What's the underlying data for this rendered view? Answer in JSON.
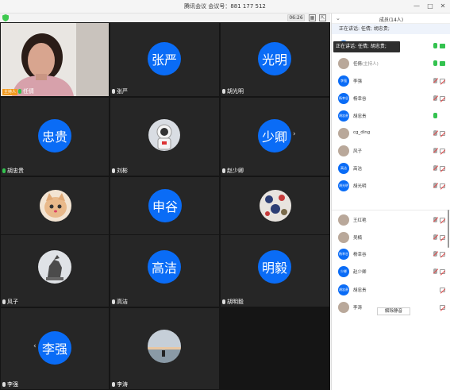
{
  "window": {
    "title": "腾讯会议 会议号：881 177 512"
  },
  "toolbar": {
    "timer": "06:26"
  },
  "tiles": [
    {
      "name": "任倩",
      "kind": "camera",
      "host_badge": "主持人"
    },
    {
      "name": "张严",
      "kind": "circle",
      "circle_text": "张严"
    },
    {
      "name": "胡光明",
      "kind": "circle",
      "circle_text": "光明"
    },
    {
      "name": "胡忠贵",
      "kind": "circle",
      "circle_text": "忠贵"
    },
    {
      "name": "刘彬",
      "kind": "photo",
      "photo": "astronaut-avatar"
    },
    {
      "name": "赵少卿",
      "kind": "circle",
      "circle_text": "少卿"
    },
    {
      "name": "",
      "kind": "photo",
      "photo": "cat-avatar"
    },
    {
      "name": "",
      "kind": "circle",
      "circle_text": "申谷"
    },
    {
      "name": "",
      "kind": "photo",
      "photo": "pattern-avatar"
    },
    {
      "name": "风子",
      "kind": "photo",
      "photo": "horse-statue-avatar"
    },
    {
      "name": "高洁",
      "kind": "circle",
      "circle_text": "高洁"
    },
    {
      "name": "胡明毅",
      "kind": "circle",
      "circle_text": "明毅"
    },
    {
      "name": "李强",
      "kind": "circle",
      "circle_text": "李强"
    },
    {
      "name": "李涛",
      "kind": "photo",
      "photo": "sunset-avatar"
    }
  ],
  "panel": {
    "title": "成员(14人)",
    "speaking": "正在讲话: 任倩; 胡忠贵;",
    "tooltip": "正在讲话: 任倩; 胡忠贵;",
    "unmute_all": "解除静音",
    "members": [
      {
        "avatar": "",
        "name": "",
        "sub": "",
        "mic": "on",
        "cam": "on"
      },
      {
        "avatar": "photo",
        "name": "任倩",
        "sub": "(主持人)",
        "mic": "on",
        "cam": "on"
      },
      {
        "avatar": "李强",
        "name": "李强",
        "sub": "",
        "mic": "muted",
        "cam": "muted"
      },
      {
        "avatar": "杨幸谷",
        "name": "杨幸谷",
        "sub": "",
        "mic": "muted",
        "cam": "muted"
      },
      {
        "avatar": "胡忠贵",
        "name": "胡忠贵",
        "sub": "",
        "mic": "on",
        "cam": "none"
      },
      {
        "avatar": "photo",
        "name": "cg_dlng",
        "sub": "",
        "mic": "muted",
        "cam": "muted"
      },
      {
        "avatar": "photo",
        "name": "风子",
        "sub": "",
        "mic": "muted",
        "cam": "muted"
      },
      {
        "avatar": "高洁",
        "name": "高洁",
        "sub": "",
        "mic": "muted",
        "cam": "muted"
      },
      {
        "avatar": "胡光明",
        "name": "胡光明",
        "sub": "",
        "mic": "muted",
        "cam": "muted"
      },
      {
        "avatar": "photo",
        "name": "王红艳",
        "sub": "",
        "mic": "muted",
        "cam": "muted"
      },
      {
        "avatar": "photo",
        "name": "吴楠",
        "sub": "",
        "mic": "muted",
        "cam": "muted"
      },
      {
        "avatar": "杨幸谷",
        "name": "杨幸谷",
        "sub": "",
        "mic": "muted",
        "cam": "muted"
      },
      {
        "avatar": "少卿",
        "name": "赵少卿",
        "sub": "",
        "mic": "muted",
        "cam": "muted"
      },
      {
        "avatar": "胡忠贵",
        "name": "胡忠贵",
        "sub": "",
        "mic": "none",
        "cam": "muted"
      },
      {
        "avatar": "photo",
        "name": "李涛",
        "sub": "",
        "mic": "none",
        "cam": "muted"
      }
    ]
  },
  "colors": {
    "accent": "#0a6cf6",
    "tile_bg": "#262626",
    "mic_active": "#33c24f",
    "muted": "#e54545"
  }
}
